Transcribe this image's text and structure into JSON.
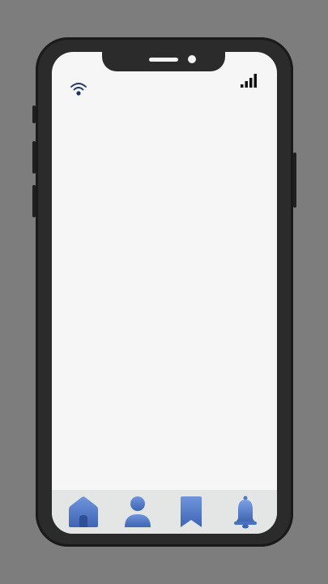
{
  "device": {
    "frame_color": "#2b2b2b",
    "screen_color": "#f6f6f6",
    "background_color": "#7d7d7d"
  },
  "status_bar": {
    "left_icon": "wifi-icon",
    "right_icon": "cellular-signal-icon"
  },
  "tab_bar": {
    "accent_color": "#4f79c9",
    "items": [
      {
        "icon": "home-icon"
      },
      {
        "icon": "profile-icon"
      },
      {
        "icon": "bookmark-icon"
      },
      {
        "icon": "bell-icon"
      }
    ]
  }
}
